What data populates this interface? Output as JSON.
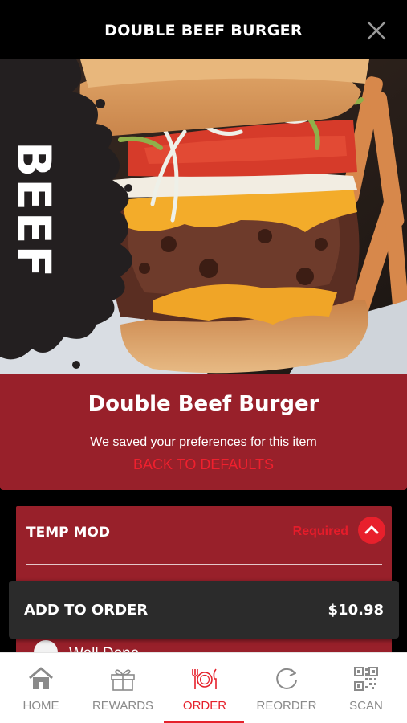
{
  "header": {
    "title": "DOUBLE BEEF BURGER",
    "close_icon": "close-icon"
  },
  "hero": {
    "badge_text": "BEEF"
  },
  "item": {
    "name": "Double Beef Burger",
    "saved_message": "We saved your preferences for this item",
    "back_to_defaults": "BACK TO DEFAULTS"
  },
  "modifier": {
    "title": "TEMP MOD",
    "required_label": "Required",
    "toggle_icon": "chevron-up-icon",
    "first_option": "Well Done"
  },
  "cart": {
    "add_label": "ADD TO ORDER",
    "price": "$10.98"
  },
  "nav": {
    "items": [
      {
        "label": "HOME",
        "icon": "home-icon"
      },
      {
        "label": "REWARDS",
        "icon": "gift-icon"
      },
      {
        "label": "ORDER",
        "icon": "utensils-icon",
        "active": true
      },
      {
        "label": "REORDER",
        "icon": "reorder-icon"
      },
      {
        "label": "SCAN",
        "icon": "qr-code-icon"
      }
    ]
  },
  "colors": {
    "brand_red": "#98202a",
    "accent_red": "#e5212b",
    "nav_gray": "#8a8a8a"
  }
}
